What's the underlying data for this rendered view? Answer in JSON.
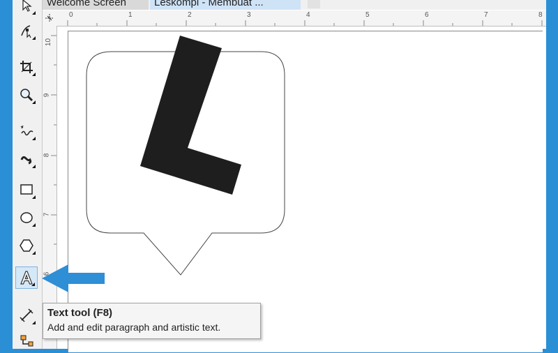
{
  "document_tabs": {
    "welcome_label": "Welcome Screen",
    "active_label": "Leskompi - Membuat ..."
  },
  "toolbox": {
    "tools": [
      {
        "name": "pick-tool"
      },
      {
        "name": "shape-tool"
      },
      {
        "name": "crop-tool"
      },
      {
        "name": "zoom-tool"
      },
      {
        "name": "freehand-tool"
      },
      {
        "name": "artistic-media-tool"
      },
      {
        "name": "rectangle-tool"
      },
      {
        "name": "ellipse-tool"
      },
      {
        "name": "polygon-tool"
      },
      {
        "name": "text-tool",
        "active": true
      },
      {
        "name": "parallel-dimension-tool"
      },
      {
        "name": "connector-tool"
      }
    ]
  },
  "ruler": {
    "horizontal_ticks": [
      "0",
      "1",
      "2",
      "3",
      "4",
      "5",
      "6",
      "7",
      "8"
    ],
    "vertical_ticks": [
      "10",
      "9",
      "8",
      "7",
      "6"
    ]
  },
  "canvas": {
    "shape_fill": "#ffffff",
    "shape_stroke": "#444444",
    "letter_color": "#1e1e1e"
  },
  "tooltip": {
    "title": "Text tool (F8)",
    "description": "Add and edit paragraph and artistic text."
  },
  "annotation": {
    "arrow_color": "#2e8ed6"
  }
}
